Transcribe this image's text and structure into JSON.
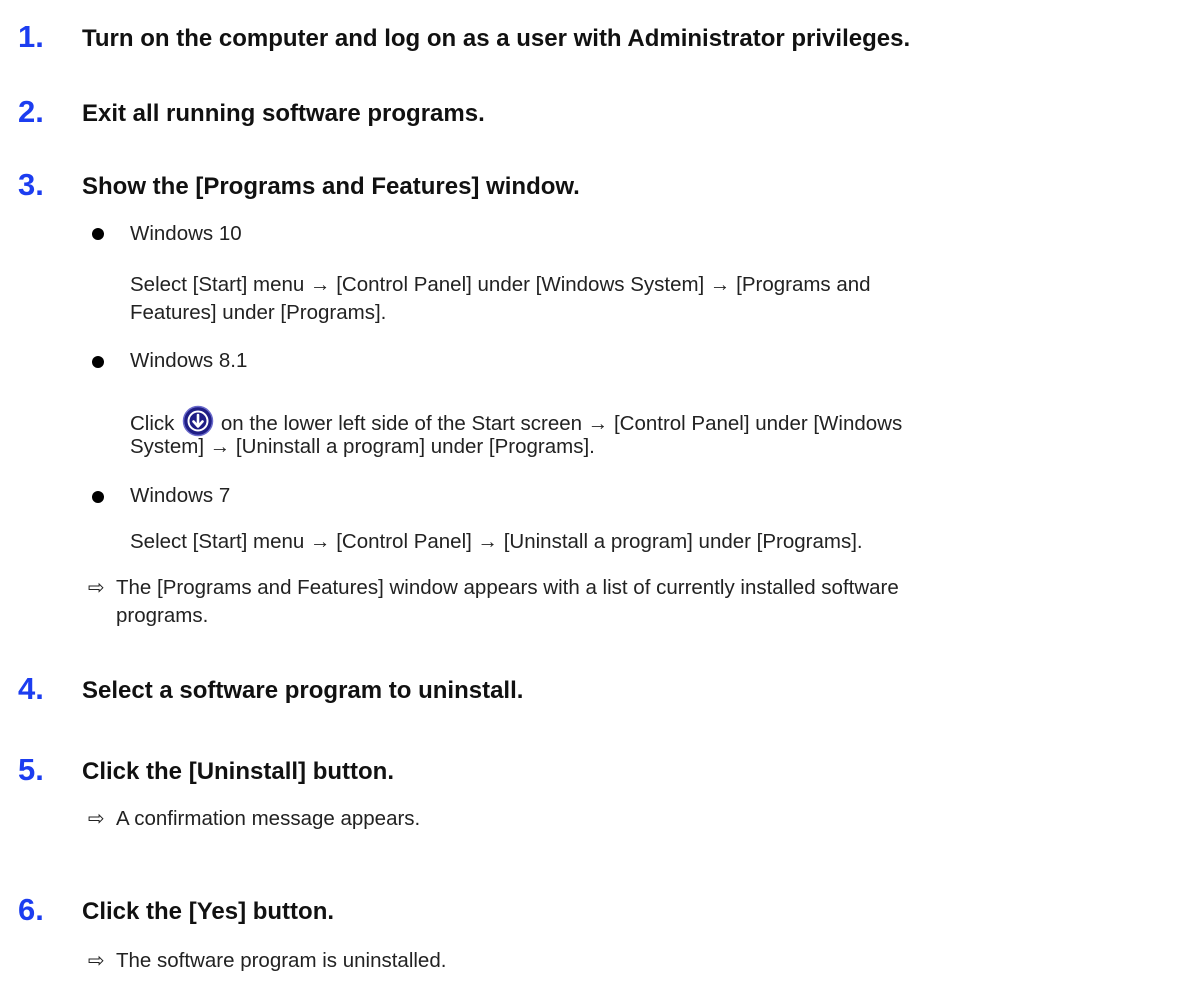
{
  "steps": [
    {
      "number": "1.",
      "title": "Turn on the computer and log on as a user with Administrator privileges."
    },
    {
      "number": "2.",
      "title": "Exit all running software programs."
    },
    {
      "number": "3.",
      "title": "Show the [Programs and Features] window."
    },
    {
      "number": "4.",
      "title": "Select a software program to uninstall."
    },
    {
      "number": "5.",
      "title": "Click the [Uninstall] button."
    },
    {
      "number": "6.",
      "title": "Click the [Yes] button."
    }
  ],
  "step3": {
    "win10": {
      "label": "Windows 10",
      "line1": "Select [Start] menu → [Control Panel] under [Windows System] → [Programs and",
      "line2": "Features] under [Programs]."
    },
    "win81": {
      "label": "Windows 8.1",
      "line1_before": "Click",
      "line1_after": "on the lower left side of the Start screen → [Control Panel] under [Windows",
      "line2": "System] → [Uninstall a program] under [Programs].",
      "icon": "down-arrow-circle-icon"
    },
    "win7": {
      "label": "Windows 7",
      "line1": "Select [Start] menu → [Control Panel] → [Uninstall a program] under [Programs]."
    },
    "result_line1": "The [Programs and Features] window appears with a list of currently installed software",
    "result_line2": "programs."
  },
  "step5_result": "A confirmation message appears.",
  "step6_result": "The software program is uninstalled.",
  "result_arrow_glyph": "⇨",
  "colors": {
    "step_number": "#1c3df0",
    "icon_fill": "#1f1e86"
  }
}
